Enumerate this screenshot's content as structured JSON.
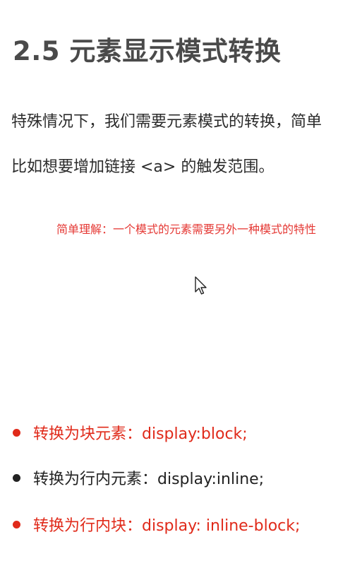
{
  "section": {
    "heading": "2.5 元素显示模式转换"
  },
  "body": {
    "paragraph_1": "特殊情况下，我们需要元素模式的转换，简单",
    "paragraph_2": "比如想要增加链接 <a> 的触发范围。"
  },
  "annotation": {
    "note": "简单理解：一个模式的元素需要另外一种模式的特性"
  },
  "list": {
    "items": [
      {
        "label": "转换为块元素：display:block;",
        "color": "#e02a1a"
      },
      {
        "label": "转换为行内元素：display:inline;",
        "color": "#222222"
      },
      {
        "label": "转换为行内块：display: inline-block;",
        "color": "#e02a1a"
      }
    ]
  },
  "cursor": {
    "icon": "mouse-pointer-icon"
  }
}
